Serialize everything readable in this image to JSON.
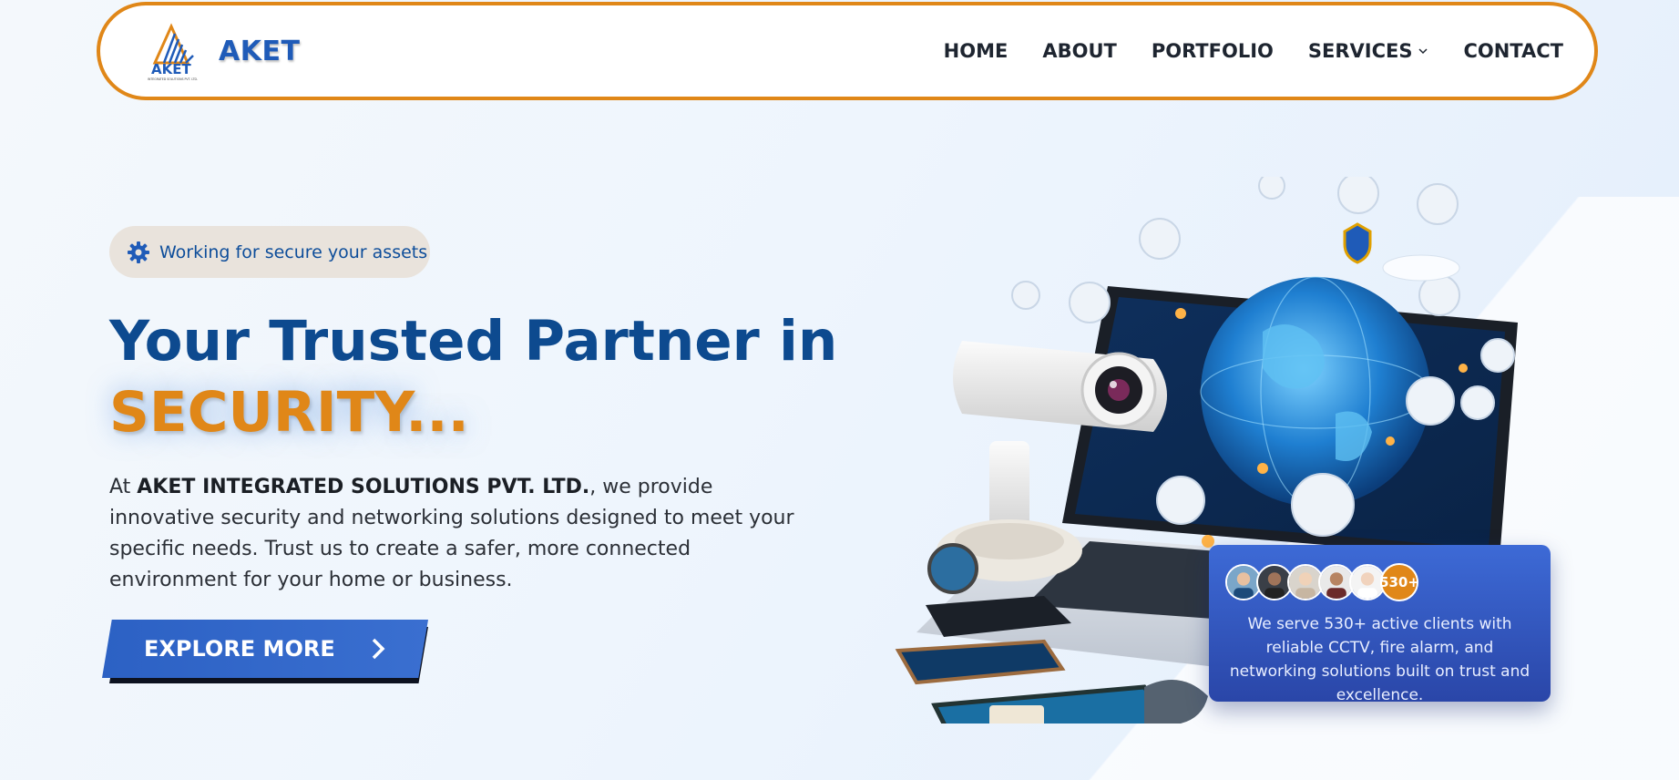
{
  "header": {
    "brand_name": "AKET",
    "logo_caption": "INTEGRATED SOLUTIONS PVT. LTD.",
    "nav": [
      {
        "label": "HOME"
      },
      {
        "label": "ABOUT"
      },
      {
        "label": "PORTFOLIO"
      },
      {
        "label": "SERVICES",
        "icon": "chevron-down-icon"
      },
      {
        "label": "CONTACT"
      }
    ]
  },
  "hero": {
    "badge_icon": "gear-icon",
    "badge_text": "Working for secure your assets",
    "title_line1": "Your Trusted Partner in",
    "title_line2": "SECURITY...",
    "desc_prefix": "At ",
    "desc_company": "AKET INTEGRATED SOLUTIONS PVT. LTD.",
    "desc_suffix": ", we provide innovative security and networking solutions designed to meet your specific needs. Trust us to create a safer, more connected environment for your home or business.",
    "cta_label": "EXPLORE MORE",
    "cta_icon": "chevron-right-icon"
  },
  "stats": {
    "count_badge": "530+",
    "text": "We serve 530+ active clients with reliable CCTV, fire alarm, and networking solutions built on trust and excellence."
  },
  "colors": {
    "accent": "#e08718",
    "primary": "#0d4a8f",
    "brand_blue": "#1f5bb8",
    "button": "#2c61c4"
  }
}
